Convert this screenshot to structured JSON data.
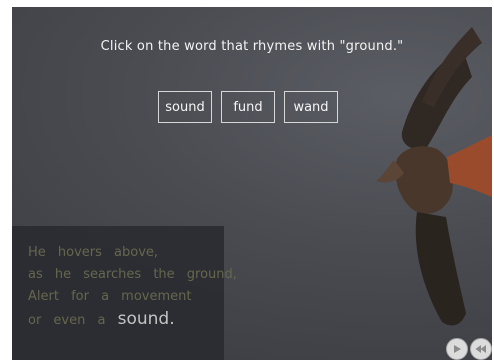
{
  "prompt": "Click on the word that rhymes with \"ground.\"",
  "choices": [
    "sound",
    "fund",
    "wand"
  ],
  "poem": {
    "lines": [
      "He hovers above,",
      "as he searches the ground,",
      "Alert for a movement",
      "or even a"
    ],
    "highlight": "sound."
  },
  "controls": {
    "play_icon": "play-icon",
    "rewind_icon": "rewind-icon"
  }
}
